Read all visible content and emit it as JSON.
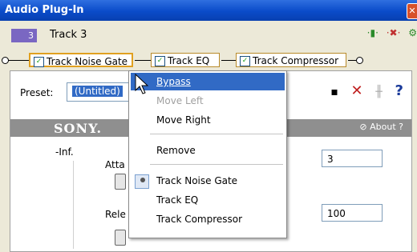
{
  "window": {
    "title": "Audio Plug-In",
    "close_glyph": "✕"
  },
  "track": {
    "number": "3",
    "name": "Track 3"
  },
  "chain": {
    "plugins": [
      {
        "label": "Track Noise Gate",
        "checked": true
      },
      {
        "label": "Track EQ",
        "checked": true
      },
      {
        "label": "Track Compressor",
        "checked": true
      }
    ]
  },
  "preset": {
    "label": "Preset:",
    "value": "(Untitled)"
  },
  "toolbar_icons": [
    "save-icon",
    "delete-icon",
    "tune-icon",
    "help-icon"
  ],
  "toolbar_glyphs": {
    "delete": "✕",
    "help": "?"
  },
  "brand": {
    "logo": "SONY.",
    "about": "About",
    "about_icon": "⃠"
  },
  "plugin_controls": {
    "inf_label": "-Inf.",
    "attack_label": "Atta",
    "attack_value": "3",
    "release_label": "Rele",
    "release_value": "100"
  },
  "context_menu": {
    "items": [
      {
        "label": "Bypass",
        "state": "highlighted"
      },
      {
        "label": "Move Left",
        "state": "disabled"
      },
      {
        "label": "Move Right",
        "state": "normal"
      },
      {
        "label": "Remove",
        "state": "normal"
      },
      {
        "label": "Track Noise Gate",
        "state": "selected"
      },
      {
        "label": "Track EQ",
        "state": "normal"
      },
      {
        "label": "Track Compressor",
        "state": "normal"
      }
    ]
  },
  "colors": {
    "title_bar": "#0a4bc9",
    "highlight": "#316ac5",
    "track_badge": "#7a67c2"
  }
}
